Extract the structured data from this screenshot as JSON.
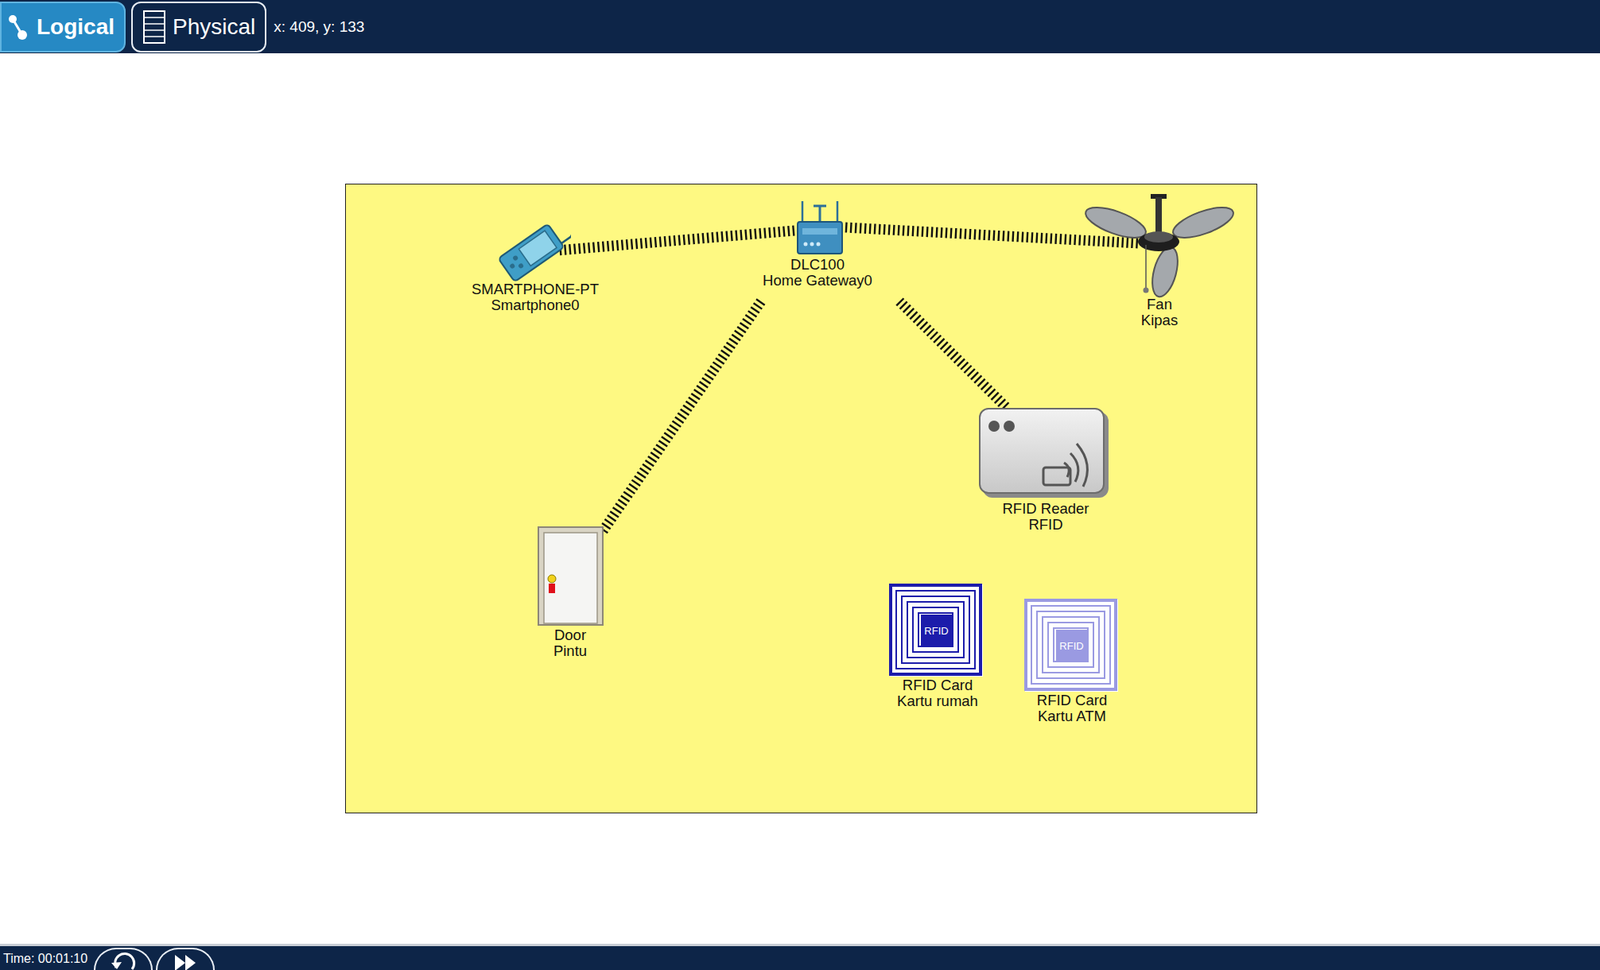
{
  "toolbar": {
    "tabs": [
      {
        "label": "Logical",
        "selected": true
      },
      {
        "label": "Physical",
        "selected": false
      }
    ],
    "coordinates": "x: 409, y: 133"
  },
  "devices": [
    {
      "kind": "smartphone",
      "model": "SMARTPHONE-PT",
      "name": "Smartphone0",
      "wireless": true
    },
    {
      "kind": "gateway",
      "model": "DLC100",
      "name": "Home Gateway0",
      "wireless": true
    },
    {
      "kind": "fan",
      "model": "Fan",
      "name": "Kipas",
      "wireless": true
    },
    {
      "kind": "reader",
      "model": "RFID Reader",
      "name": "RFID",
      "wireless": true
    },
    {
      "kind": "door",
      "model": "Door",
      "name": "Pintu",
      "wireless": true
    },
    {
      "kind": "card",
      "model": "RFID Card",
      "name": "Kartu rumah",
      "wireless": false,
      "chip_label": "RFID",
      "color": "#1c1cab"
    },
    {
      "kind": "card",
      "model": "RFID Card",
      "name": "Kartu ATM",
      "wireless": false,
      "chip_label": "RFID",
      "color": "#9a9ae2"
    }
  ],
  "status_bar": {
    "time": "Time: 00:01:10"
  }
}
